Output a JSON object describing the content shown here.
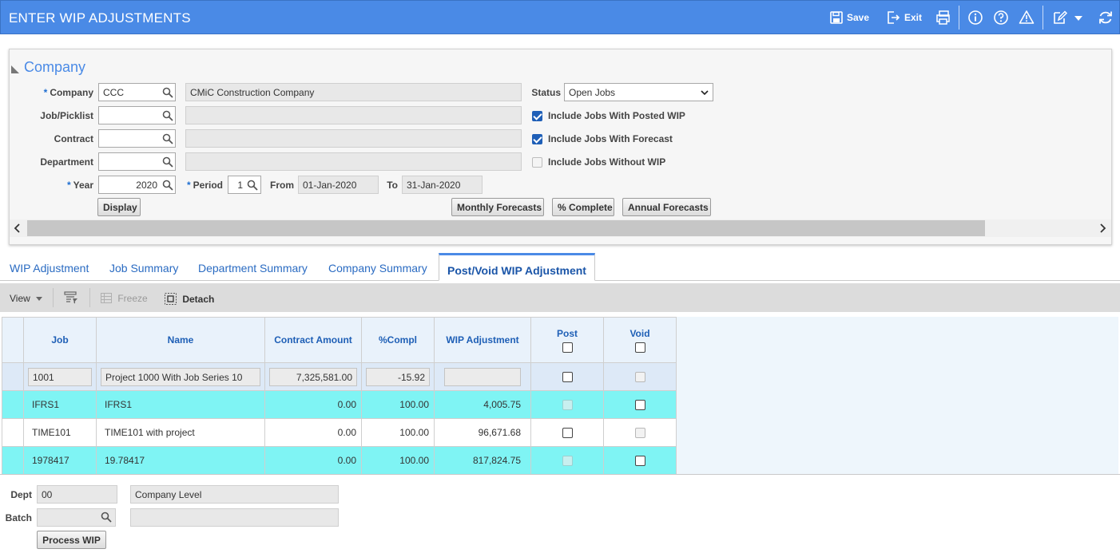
{
  "window": {
    "title": "ENTER WIP ADJUSTMENTS",
    "save_label": "Save",
    "exit_label": "Exit"
  },
  "company_panel": {
    "title": "Company",
    "company_label": "Company",
    "company_value": "CCC",
    "company_name": "CMiC Construction Company",
    "job_label": "Job/Picklist",
    "job_value": "",
    "contract_label": "Contract",
    "contract_value": "",
    "department_label": "Department",
    "department_value": "",
    "year_label": "Year",
    "year_value": "2020",
    "period_label": "Period",
    "period_value": "1",
    "from_label": "From",
    "from_value": "01-Jan-2020",
    "to_label": "To",
    "to_value": "31-Jan-2020",
    "status_label": "Status",
    "status_value": "Open Jobs",
    "include_posted_label": "Include Jobs With Posted WIP",
    "include_posted_checked": true,
    "include_forecast_label": "Include Jobs With Forecast",
    "include_forecast_checked": true,
    "include_without_label": "Include Jobs Without WIP",
    "include_without_checked": false,
    "display_button": "Display",
    "monthly_forecasts_button": "Monthly Forecasts",
    "percent_complete_button": "% Complete",
    "annual_forecasts_button": "Annual Forecasts"
  },
  "tabs": [
    {
      "label": "WIP Adjustment",
      "active": false
    },
    {
      "label": "Job Summary",
      "active": false
    },
    {
      "label": "Department Summary",
      "active": false
    },
    {
      "label": "Company Summary",
      "active": false
    },
    {
      "label": "Post/Void WIP Adjustment",
      "active": true
    }
  ],
  "grid_toolbar": {
    "view_label": "View",
    "freeze_label": "Freeze",
    "detach_label": "Detach"
  },
  "grid": {
    "columns": [
      "Job",
      "Name",
      "Contract Amount",
      "%Compl",
      "WIP Adjustment",
      "Post",
      "Void"
    ],
    "rows": [
      {
        "job": "1001",
        "name": "Project 1000 With Job Series 10",
        "contract_amount": "7,325,581.00",
        "compl": "-15.92",
        "wip_adjustment": "",
        "post": false,
        "void": false
      },
      {
        "job": "IFRS1",
        "name": "IFRS1",
        "contract_amount": "0.00",
        "compl": "100.00",
        "wip_adjustment": "4,005.75",
        "post": false,
        "void": false
      },
      {
        "job": "TIME101",
        "name": "TIME101 with project",
        "contract_amount": "0.00",
        "compl": "100.00",
        "wip_adjustment": "96,671.68",
        "post": false,
        "void": false
      },
      {
        "job": "1978417",
        "name": "19.78417",
        "contract_amount": "0.00",
        "compl": "100.00",
        "wip_adjustment": "817,824.75",
        "post": false,
        "void": false
      }
    ]
  },
  "bottom_form": {
    "dept_label": "Dept",
    "dept_value": "00",
    "dept_name": "Company Level",
    "batch_label": "Batch",
    "batch_value": "",
    "batch_name": "",
    "process_button": "Process WIP"
  },
  "colors": {
    "header_blue": "#4a8ae6",
    "teal_row": "#7ff4f4",
    "selected_row": "#dde9f7",
    "link_blue": "#2a6bc2"
  }
}
